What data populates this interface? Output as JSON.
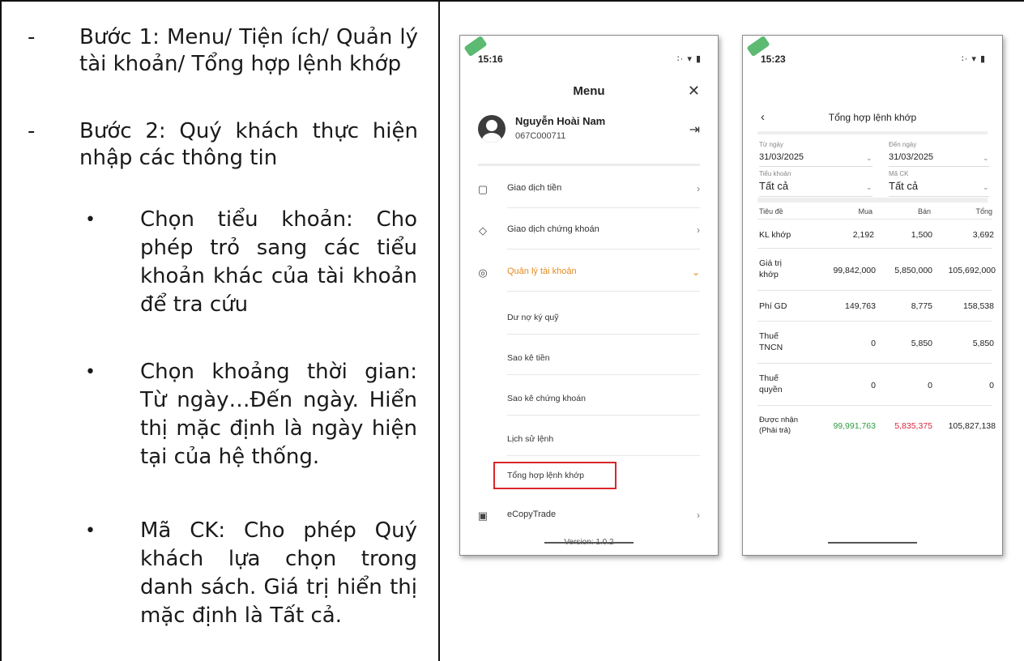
{
  "instructions": {
    "step1": {
      "bullet": "-",
      "text": "Bước 1: Menu/ Tiện ích/ Quản lý tài khoản/ Tổng hợp lệnh khớp"
    },
    "step2": {
      "bullet": "-",
      "text": "Bước 2: Quý khách thực hiện nhập các thông tin"
    },
    "bullets": [
      {
        "marker": "•",
        "text": "Chọn tiểu khoản: Cho phép trỏ sang các tiểu khoản khác của tài khoản để tra cứu"
      },
      {
        "marker": "•",
        "text": "Chọn khoảng thời gian: Từ ngày…Đến ngày. Hiển thị mặc định là ngày hiện tại của hệ thống."
      },
      {
        "marker": "•",
        "text": "Mã CK: Cho phép Quý khách lựa chọn trong danh sách. Giá trị hiển thị mặc định là Tất cả."
      }
    ]
  },
  "menu_screen": {
    "time": "15:16",
    "status_icons": "∶· ▾ ▮",
    "title": "Menu",
    "close_icon": "✕",
    "user": {
      "name": "Nguyễn Hoài Nam",
      "id": "067C000711"
    },
    "logout_icon": "⇥",
    "items": [
      {
        "icon": "▢",
        "label": "Giao dịch tiền",
        "chevron": "›"
      },
      {
        "icon": "◇",
        "label": "Giao dịch chứng khoán",
        "chevron": "›"
      },
      {
        "icon": "◎",
        "label": "Quản lý tài khoản",
        "chevron": "⌄"
      }
    ],
    "sub_items": [
      "Dư nợ ký quỹ",
      "Sao kê tiền",
      "Sao kê chứng khoán",
      "Lịch sử lệnh",
      "Tổng hợp lệnh khớp"
    ],
    "extra_item": {
      "icon": "▣",
      "label": "eCopyTrade",
      "chevron": "›"
    },
    "version": "Version: 1.0.2",
    "accent_color": "#e58a1f",
    "highlight_color": "#d9262a"
  },
  "summary_screen": {
    "time": "15:23",
    "status_icons": "∶· ▾ ▮",
    "back_icon": "‹",
    "title": "Tổng hợp lệnh khớp",
    "filters": {
      "from_label": "Từ ngày",
      "from_value": "31/03/2025",
      "to_label": "Đến ngày",
      "to_value": "31/03/2025",
      "sub_account_label": "Tiểu khoản",
      "sub_account_value": "Tất cả",
      "symbol_label": "Mã CK",
      "symbol_value": "Tất cả",
      "dropdown_icon": "⌄"
    },
    "table": {
      "headers": [
        "Tiêu đề",
        "Mua",
        "Bán",
        "Tổng"
      ],
      "rows": [
        {
          "title": "KL khớp",
          "buy": "2,192",
          "sell": "1,500",
          "total": "3,692"
        },
        {
          "title": "Giá trị khớp",
          "buy": "99,842,000",
          "sell": "5,850,000",
          "total": "105,692,000"
        },
        {
          "title": "Phí GD",
          "buy": "149,763",
          "sell": "8,775",
          "total": "158,538"
        },
        {
          "title": "Thuế TNCN",
          "buy": "0",
          "sell": "5,850",
          "total": "5,850"
        },
        {
          "title": "Thuế quyền",
          "buy": "0",
          "sell": "0",
          "total": "0"
        },
        {
          "title": "Được nhận (Phải trả)",
          "buy": "99,991,763",
          "sell": "5,835,375",
          "total": "105,827,138"
        }
      ],
      "buy_color": "#2e9b3e",
      "sell_color": "#d9263a"
    }
  }
}
